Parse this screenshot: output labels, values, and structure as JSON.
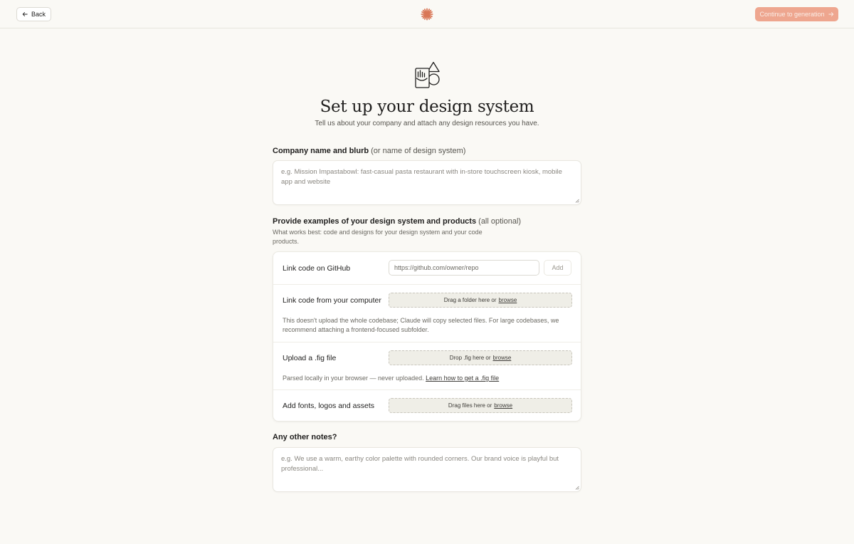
{
  "header": {
    "back_label": "Back",
    "continue_label": "Continue to generation",
    "brand_color": "#d97757",
    "continue_color": "#eea68f"
  },
  "hero": {
    "title": "Set up your design system",
    "subtitle": "Tell us about your company and attach any design resources you have."
  },
  "company": {
    "label": "Company name and blurb",
    "label_muted": "(or name of design system)",
    "placeholder": "e.g. Mission Impastabowl: fast-casual pasta restaurant with in-store touchscreen kiosk, mobile app and website"
  },
  "examples": {
    "label": "Provide examples of your design system and products",
    "label_muted": "(all optional)",
    "help": "What works best: code and designs for your design system and your code products.",
    "github": {
      "label": "Link code on GitHub",
      "placeholder": "https://github.com/owner/repo",
      "add_label": "Add"
    },
    "computer": {
      "label": "Link code from your computer",
      "drop_text": "Drag a folder here or",
      "browse_label": "browse",
      "help": "This doesn't upload the whole codebase; Claude will copy selected files. For large codebases, we recommend attaching a frontend-focused subfolder."
    },
    "fig": {
      "label": "Upload a .fig file",
      "drop_text": "Drop .fig here or",
      "browse_label": "browse",
      "help": "Parsed locally in your browser — never uploaded.",
      "learn_link": "Learn how to get a .fig file"
    },
    "assets": {
      "label": "Add fonts, logos and assets",
      "drop_text": "Drag files here or",
      "browse_label": "browse"
    }
  },
  "notes": {
    "label": "Any other notes?",
    "placeholder": "e.g. We use a warm, earthy color palette with rounded corners. Our brand voice is playful but professional..."
  }
}
